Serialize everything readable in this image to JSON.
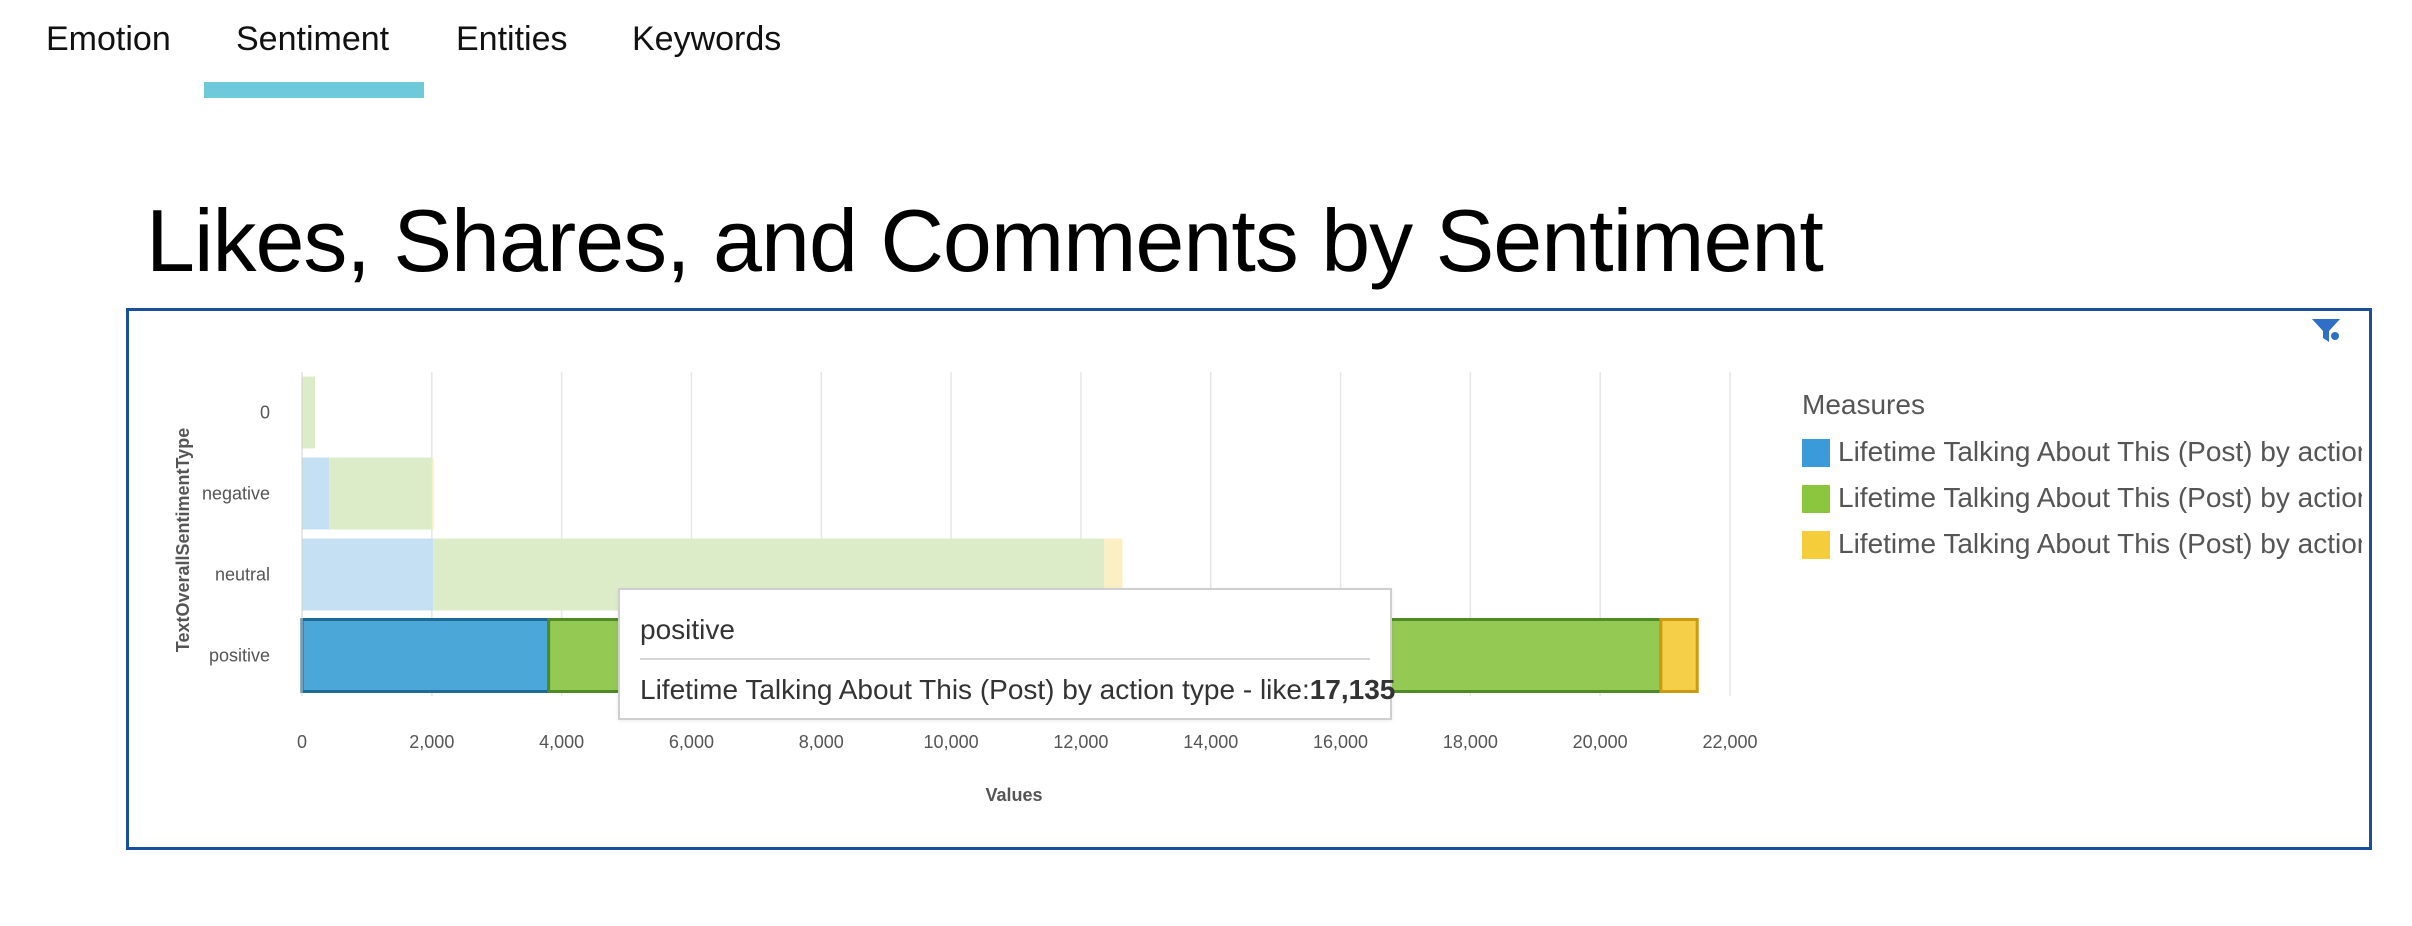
{
  "tabs": [
    {
      "label": "Emotion"
    },
    {
      "label": "Sentiment",
      "active": true
    },
    {
      "label": "Entities"
    },
    {
      "label": "Keywords"
    }
  ],
  "page_title": "Likes, Shares, and Comments by Sentiment",
  "filter_icon": "filter-funnel-icon",
  "colors": {
    "accent_tab": "#6ecadb",
    "frame_border": "#1b4f9c",
    "series_blue": "#4aa7d8",
    "series_green": "#94c954",
    "series_yellow": "#f4cf47"
  },
  "legend": {
    "title": "Measures",
    "items": [
      {
        "label": "Lifetime Talking About This (Post) by action type - like",
        "color": "#3b9ad9"
      },
      {
        "label": "Lifetime Talking About This (Post) by action type - share",
        "color": "#8cc63f"
      },
      {
        "label": "Lifetime Talking About This (Post) by action type - comment",
        "color": "#f5cd3a"
      }
    ]
  },
  "tooltip": {
    "title": "positive",
    "label": "Lifetime Talking About This (Post) by action type - like:",
    "value": "17,135"
  },
  "chart_data": {
    "type": "bar",
    "orientation": "horizontal",
    "stacked": true,
    "categories": [
      "0",
      "negative",
      "neutral",
      "positive"
    ],
    "highlighted_category": "positive",
    "xlabel": "Values",
    "ylabel": "TextOverallSentimentType",
    "xlim": [
      0,
      22000
    ],
    "x_ticks": [
      0,
      2000,
      4000,
      6000,
      8000,
      10000,
      12000,
      14000,
      16000,
      18000,
      20000,
      22000
    ],
    "x_tick_labels": [
      "0",
      "2,000",
      "4,000",
      "6,000",
      "8,000",
      "10,000",
      "12,000",
      "14,000",
      "16,000",
      "18,000",
      "20,000",
      "22,000"
    ],
    "grid": true,
    "legend_position": "right",
    "series": [
      {
        "name": "Lifetime Talking About This (Post) by action type - like",
        "color": "#4aa7d8",
        "values": [
          0,
          420,
          2020,
          3800
        ]
      },
      {
        "name": "Lifetime Talking About This (Post) by action type - share",
        "color": "#94c954",
        "values": [
          200,
          1580,
          10340,
          17135
        ]
      },
      {
        "name": "Lifetime Talking About This (Post) by action type - comment",
        "color": "#f4cf47",
        "values": [
          0,
          30,
          280,
          560
        ]
      }
    ]
  }
}
